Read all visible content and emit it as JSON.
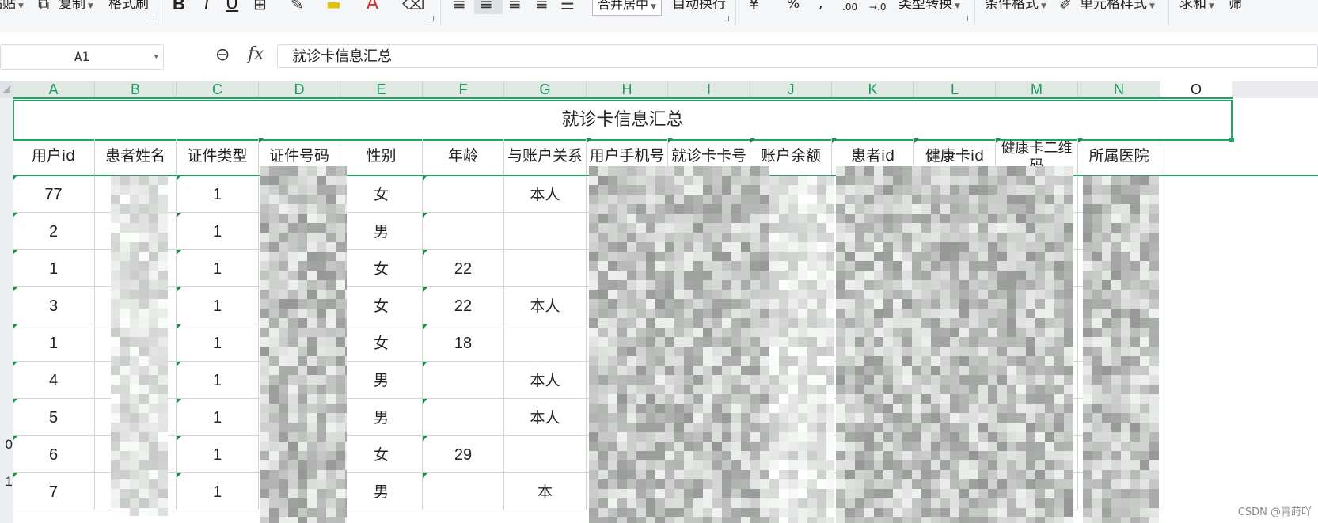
{
  "toolbar": {
    "paste_label": "粘贴",
    "copy_label": "复制",
    "format_painter_label": "格式刷",
    "bold_label": "B",
    "italic_label": "I",
    "underline_label": "U",
    "merge_center_label": "合并居中",
    "auto_wrap_label": "自动换行",
    "percent_label": "%",
    "comma_label": ",",
    "inc_decimal_label": ".00",
    "dec_decimal_label": "→.0",
    "type_convert_label": "类型转换",
    "conditional_format_label": "条件格式",
    "cell_style_label": "单元格样式",
    "sum_label": "求和",
    "filter_label": "筛"
  },
  "formula_bar": {
    "name_box": "A1",
    "fx_label": "fx",
    "formula_value": "就诊卡信息汇总"
  },
  "columns": [
    "A",
    "B",
    "C",
    "D",
    "E",
    "F",
    "G",
    "H",
    "I",
    "J",
    "K",
    "L",
    "M",
    "N",
    "O"
  ],
  "sheet": {
    "title": "就诊卡信息汇总",
    "headers": [
      "用户id",
      "患者姓名",
      "证件类型",
      "证件号码",
      "性别",
      "年龄",
      "与账户关系",
      "用户手机号",
      "就诊卡卡号",
      "账户余额",
      "患者id",
      "健康卡id",
      "健康卡二维码",
      "所属医院"
    ],
    "rows": [
      {
        "user_id": "77",
        "id_type": "1",
        "gender": "女",
        "age": "",
        "relation": "本人"
      },
      {
        "user_id": "2",
        "id_type": "1",
        "gender": "男",
        "age": "",
        "relation": ""
      },
      {
        "user_id": "1",
        "id_type": "1",
        "gender": "女",
        "age": "22",
        "relation": ""
      },
      {
        "user_id": "3",
        "id_type": "1",
        "gender": "女",
        "age": "22",
        "relation": "本人"
      },
      {
        "user_id": "1",
        "id_type": "1",
        "gender": "女",
        "age": "18",
        "relation": ""
      },
      {
        "user_id": "4",
        "id_type": "1",
        "gender": "男",
        "age": "",
        "relation": "本人"
      },
      {
        "user_id": "5",
        "id_type": "1",
        "gender": "男",
        "age": "",
        "relation": "本人"
      },
      {
        "user_id": "6",
        "id_type": "1",
        "gender": "女",
        "age": "29",
        "relation": ""
      },
      {
        "user_id": "7",
        "id_type": "1",
        "gender": "男",
        "age": "",
        "relation": "本"
      }
    ],
    "row_numbers": [
      "0",
      "1"
    ]
  },
  "watermark": "CSDN @青莳吖",
  "colors": {
    "accent_green": "#1fa463",
    "column_letter": "#1a9a59",
    "gridline": "#d4d4d4"
  }
}
